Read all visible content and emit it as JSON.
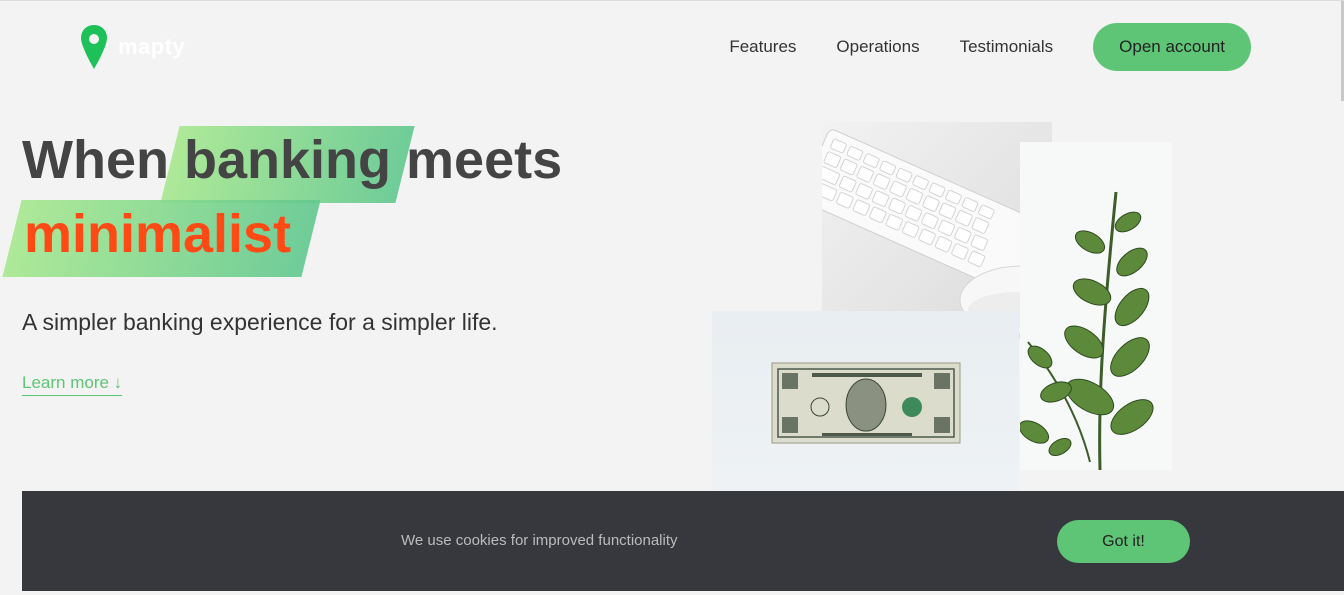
{
  "nav": {
    "logo_text": "mapty",
    "links": [
      "Features",
      "Operations",
      "Testimonials"
    ],
    "cta_label": "Open account"
  },
  "hero": {
    "title_word1": "When",
    "title_highlight1": "banking",
    "title_word2": "meets",
    "title_highlight2": "minimalist",
    "subtitle": "A simpler banking experience for a simpler life.",
    "learn_more": "Learn more ↓"
  },
  "cookie": {
    "message": "We use cookies for improved functionality",
    "button_label": "Got it!"
  },
  "colors": {
    "accent_green": "#5ec576",
    "highlight_orange": "#ff4a16",
    "cookie_bg": "#37383d",
    "page_bg": "#f3f3f3"
  },
  "icons": {
    "logo": "map-pin-icon"
  }
}
